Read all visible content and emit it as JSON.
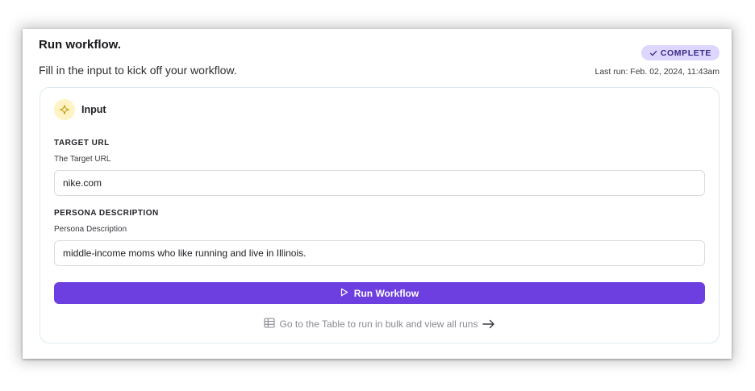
{
  "header": {
    "title": "Run workflow.",
    "subtitle": "Fill in the input to kick off your workflow."
  },
  "status": {
    "badge_label": "COMPLETE",
    "badge_icon": "check-icon",
    "last_run": "Last run: Feb. 02, 2024, 11:43am"
  },
  "input_panel": {
    "icon": "sparkle-icon",
    "title": "Input",
    "fields": [
      {
        "label": "TARGET URL",
        "description": "The Target URL",
        "value": "nike.com"
      },
      {
        "label": "PERSONA DESCRIPTION",
        "description": "Persona Description",
        "value": "middle-income moms who like running and live in Illinois."
      }
    ],
    "run_button": {
      "icon": "play-icon",
      "label": "Run Workflow"
    },
    "table_link": {
      "icon": "table-icon",
      "label": "Go to the Table to run in bulk and view all runs",
      "arrow_icon": "arrow-right-icon"
    }
  },
  "colors": {
    "accent": "#6d3fe0",
    "badge_bg": "#ddd6fe",
    "badge_text": "#3b2a84",
    "icon_bg": "#fdf3c4"
  }
}
